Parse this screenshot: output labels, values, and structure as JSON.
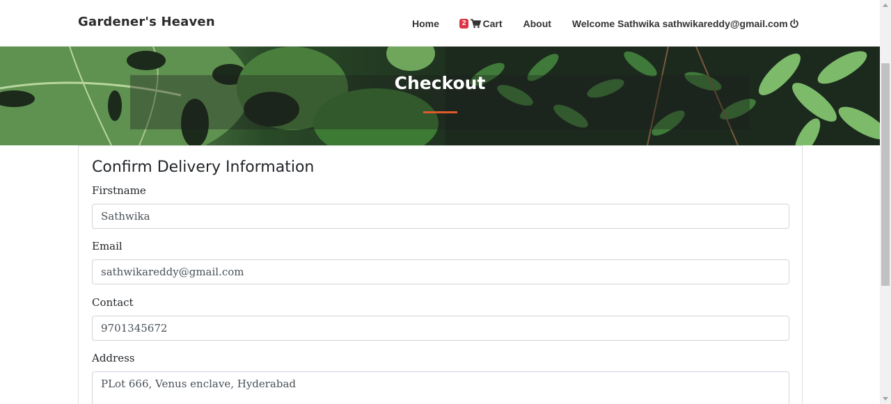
{
  "brand": "Gardener's Heaven",
  "nav": {
    "home": "Home",
    "cart_count": "2",
    "cart": "Cart",
    "about": "About",
    "welcome": "Welcome Sathwika sathwikareddy@gmail.com"
  },
  "hero": {
    "title": "Checkout"
  },
  "form": {
    "title": "Confirm Delivery Information",
    "firstname_label": "Firstname",
    "firstname_value": "Sathwika",
    "email_label": "Email",
    "email_value": "sathwikareddy@gmail.com",
    "contact_label": "Contact",
    "contact_value": "9701345672",
    "address_label": "Address",
    "address_value": "PLot 666, Venus enclave, Hyderabad"
  },
  "colors": {
    "accent_underline": "#e05a2b",
    "badge": "#dc3545"
  }
}
